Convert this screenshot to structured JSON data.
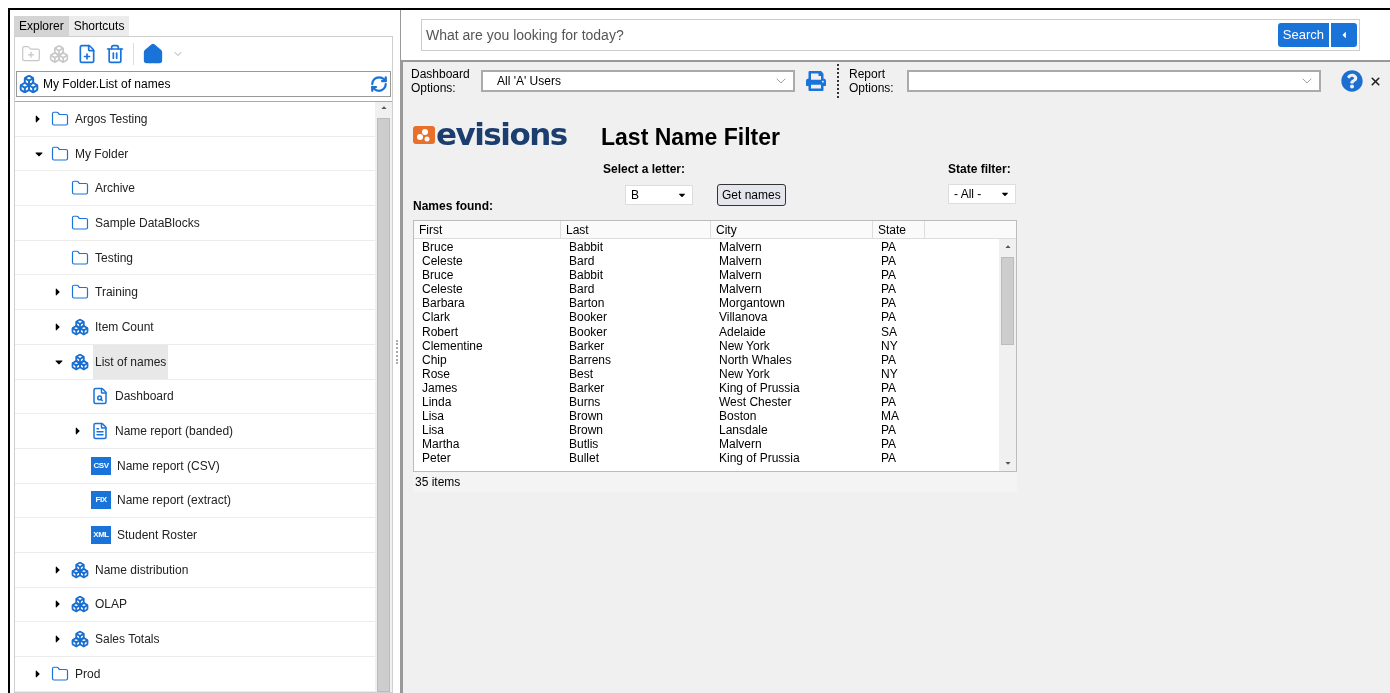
{
  "sidebar": {
    "tabs": [
      {
        "label": "Explorer",
        "selected": true
      },
      {
        "label": "Shortcuts",
        "selected": false
      }
    ],
    "path": "My Folder.List of names",
    "tree": [
      {
        "label": "Argos Testing",
        "kind": "folder",
        "expanded": false,
        "selected": false
      },
      {
        "label": "My Folder",
        "kind": "folder",
        "expanded": true,
        "selected": false,
        "children": [
          {
            "label": "Archive",
            "kind": "folder",
            "selected": false
          },
          {
            "label": "Sample DataBlocks",
            "kind": "folder",
            "selected": false
          },
          {
            "label": "Testing",
            "kind": "folder",
            "selected": false
          },
          {
            "label": "Training",
            "kind": "folder",
            "expanded": false,
            "selected": false
          },
          {
            "label": "Item Count",
            "kind": "datablock",
            "expanded": false,
            "selected": false
          },
          {
            "label": "List of names",
            "kind": "datablock",
            "expanded": true,
            "selected": true,
            "children": [
              {
                "label": "Dashboard",
                "kind": "dashboard",
                "selected": false
              },
              {
                "label": "Name report (banded)",
                "kind": "banded",
                "expanded": false,
                "selected": false
              },
              {
                "label": "Name report (CSV)",
                "kind": "tagged",
                "tag": "CSV",
                "selected": false
              },
              {
                "label": "Name report (extract)",
                "kind": "tagged",
                "tag": "FIX",
                "selected": false
              },
              {
                "label": "Student Roster",
                "kind": "tagged",
                "tag": "XML",
                "selected": false
              }
            ]
          },
          {
            "label": "Name distribution",
            "kind": "datablock",
            "expanded": false,
            "selected": false
          },
          {
            "label": "OLAP",
            "kind": "datablock",
            "expanded": false,
            "selected": false
          },
          {
            "label": "Sales Totals",
            "kind": "datablock",
            "expanded": false,
            "selected": false
          }
        ]
      },
      {
        "label": "Prod",
        "kind": "folder",
        "expanded": false,
        "selected": false
      }
    ]
  },
  "search": {
    "placeholder": "What are you looking for today?",
    "button": "Search"
  },
  "options_bar": {
    "dashboard_label": "Dashboard Options:",
    "dashboard_value": "All 'A' Users",
    "report_label": "Report Options:"
  },
  "dashboard": {
    "logo_text": "evisions",
    "title": "Last Name Filter",
    "letter_label": "Select a letter:",
    "letter_value": "B",
    "get_button": "Get names",
    "state_label": "State filter:",
    "state_value": "- All -",
    "names_label": "Names found:",
    "table": {
      "columns": [
        "First",
        "Last",
        "City",
        "State"
      ],
      "rows": [
        [
          "Bruce",
          "Babbit",
          "Malvern",
          "PA"
        ],
        [
          "Celeste",
          "Bard",
          "Malvern",
          "PA"
        ],
        [
          "Bruce",
          "Babbit",
          "Malvern",
          "PA"
        ],
        [
          "Celeste",
          "Bard",
          "Malvern",
          "PA"
        ],
        [
          "Barbara",
          "Barton",
          "Morgantown",
          "PA"
        ],
        [
          "Clark",
          "Booker",
          "Villanova",
          "PA"
        ],
        [
          "Robert",
          "Booker",
          "Adelaide",
          "SA"
        ],
        [
          "Clementine",
          "Barker",
          "New York",
          "NY"
        ],
        [
          "Chip",
          "Barrens",
          "North Whales",
          "PA"
        ],
        [
          "Rose",
          "Best",
          "New York",
          "NY"
        ],
        [
          "James",
          "Barker",
          "King of Prussia",
          "PA"
        ],
        [
          "Linda",
          "Burns",
          "West Chester",
          "PA"
        ],
        [
          "Lisa",
          "Brown",
          "Boston",
          "MA"
        ],
        [
          "Lisa",
          "Brown",
          "Lansdale",
          "PA"
        ],
        [
          "Martha",
          "Butlis",
          "Malvern",
          "PA"
        ],
        [
          "Peter",
          "Bullet",
          "King of Prussia",
          "PA"
        ]
      ]
    },
    "status": "35 items"
  }
}
